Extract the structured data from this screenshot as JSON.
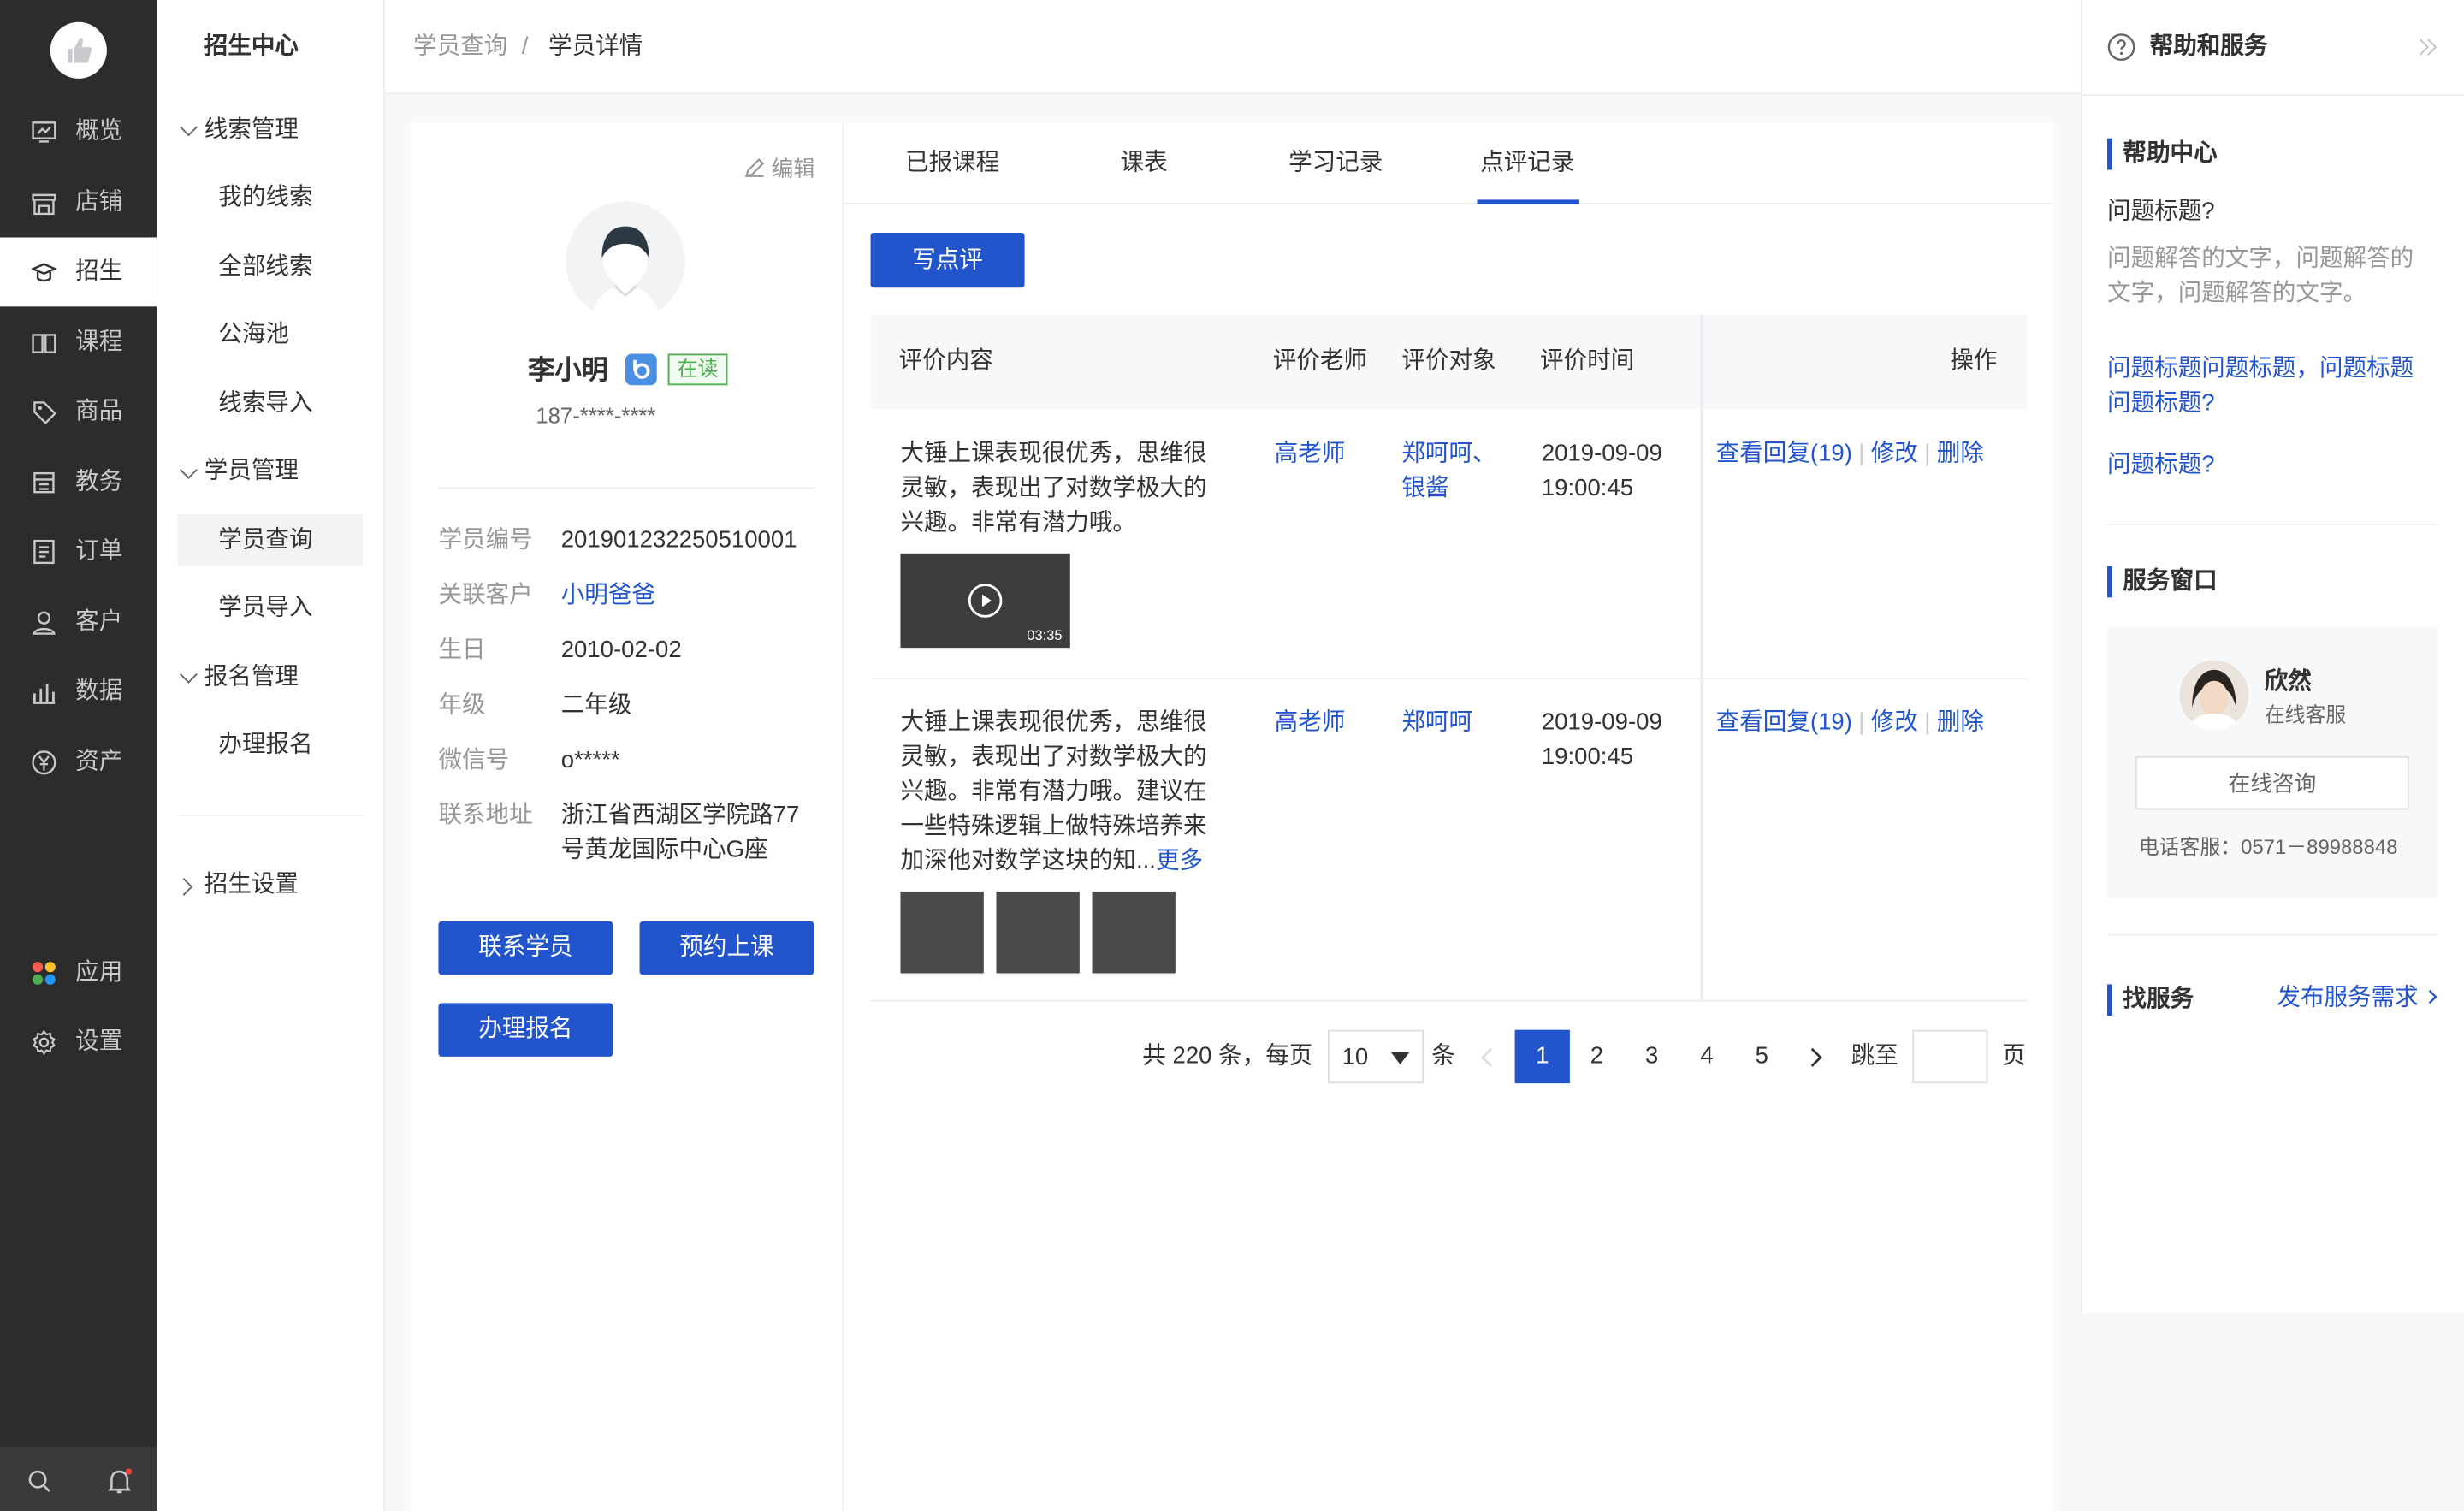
{
  "nav": {
    "items": [
      {
        "label": "概览",
        "icon": "overview-icon"
      },
      {
        "label": "店铺",
        "icon": "store-icon"
      },
      {
        "label": "招生",
        "icon": "graduation-cap-icon"
      },
      {
        "label": "课程",
        "icon": "book-icon"
      },
      {
        "label": "商品",
        "icon": "tag-icon"
      },
      {
        "label": "教务",
        "icon": "calendar-icon"
      },
      {
        "label": "订单",
        "icon": "order-icon"
      },
      {
        "label": "客户",
        "icon": "user-icon"
      },
      {
        "label": "数据",
        "icon": "bar-chart-icon"
      },
      {
        "label": "资产",
        "icon": "yuan-icon"
      },
      {
        "label": "应用",
        "icon": "apps-icon"
      },
      {
        "label": "设置",
        "icon": "gear-icon"
      }
    ],
    "active": "招生"
  },
  "subnav": {
    "title": "招生中心",
    "groups": [
      {
        "label": "线索管理",
        "items": [
          "我的线索",
          "全部线索",
          "公海池",
          "线索导入"
        ]
      },
      {
        "label": "学员管理",
        "items": [
          "学员查询",
          "学员导入"
        ]
      },
      {
        "label": "报名管理",
        "items": [
          "办理报名"
        ]
      },
      {
        "label": "招生设置",
        "items": []
      }
    ],
    "active_item": "学员查询"
  },
  "breadcrumb": {
    "parent": "学员查询",
    "separator": "/",
    "current": "学员详情"
  },
  "profile": {
    "edit_label": "编辑",
    "name": "李小明",
    "status": "在读",
    "phone": "187-****-****",
    "fields": [
      {
        "key": "学员编号",
        "value": "201901232250510001"
      },
      {
        "key": "关联客户",
        "value": "小明爸爸"
      },
      {
        "key": "生日",
        "value": "2010-02-02"
      },
      {
        "key": "年级",
        "value": "二年级"
      },
      {
        "key": "微信号",
        "value": "o*****"
      },
      {
        "key": "联系地址",
        "value": "浙江省西湖区学院路77号黄龙国际中心G座"
      }
    ],
    "buttons": {
      "contact": "联系学员",
      "book": "预约上课",
      "enroll": "办理报名"
    }
  },
  "tabs": [
    "已报课程",
    "课表",
    "学习记录",
    "点评记录"
  ],
  "active_tab": "点评记录",
  "write_review_button": "写点评",
  "table": {
    "headers": [
      "评价内容",
      "评价老师",
      "评价对象",
      "评价时间",
      "操作"
    ],
    "rows": [
      {
        "content": "大锤上课表现很优秀，思维很灵敏，表现出了对数学极大的兴趣。非常有潜力哦。",
        "video_duration": "03:35",
        "teacher": "高老师",
        "target": "郑呵呵、银酱",
        "date": "2019-09-09",
        "time": "19:00:45",
        "ops": {
          "view": "查看回复(19)",
          "edit": "修改",
          "delete": "删除"
        }
      },
      {
        "content": "大锤上课表现很优秀，思维很灵敏，表现出了对数学极大的兴趣。非常有潜力哦。建议在一些特殊逻辑上做特殊培养来加深他对数学这块的知...",
        "more_label": "更多",
        "teacher": "高老师",
        "target": "郑呵呵",
        "date": "2019-09-09",
        "time": "19:00:45",
        "ops": {
          "view": "查看回复(19)",
          "edit": "修改",
          "delete": "删除"
        }
      }
    ]
  },
  "pagination": {
    "total_text": "共 220 条，每页",
    "page_size": "10",
    "unit": "条",
    "pages": [
      "1",
      "2",
      "3",
      "4",
      "5"
    ],
    "current": "1",
    "jump_label": "跳至",
    "page_suffix": "页"
  },
  "help": {
    "title": "帮助和服务",
    "center_title": "帮助中心",
    "question": "问题标题?",
    "answer": "问题解答的文字，问题解答的文字，问题解答的文字。",
    "link1": "问题标题问题标题，问题标题问题标题?",
    "link2": "问题标题?",
    "service_title": "服务窗口",
    "agent_name": "欣然",
    "agent_role": "在线客服",
    "consult_button": "在线咨询",
    "phone_line": "电话客服：0571－89988848",
    "find_service": "找服务",
    "publish_link": "发布服务需求"
  },
  "colors": {
    "primary": "#2255cc",
    "nav_bg": "#2c2c2d",
    "status_green": "#4caf50"
  }
}
